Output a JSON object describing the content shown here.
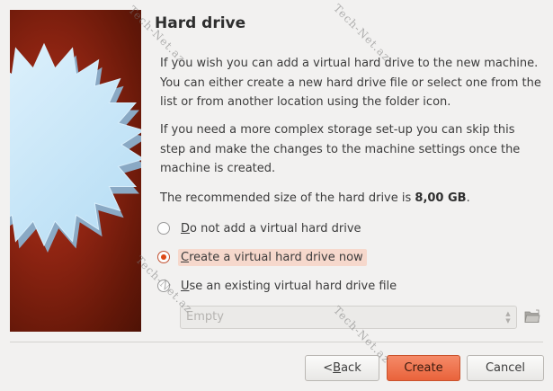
{
  "dialog": {
    "title": "Hard drive",
    "paragraph1": "If you wish you can add a virtual hard drive to the new machine. You can either create a new hard drive file or select one from the list or from another location using the folder icon.",
    "paragraph2": "If you need a more complex storage set-up you can skip this step and make the changes to the machine settings once the machine is created.",
    "recommended_prefix": "The recommended size of the hard drive is ",
    "recommended_size": "8,00 GB",
    "recommended_suffix": "."
  },
  "options": [
    {
      "label_mnemonic": "D",
      "label_rest": "o not add a virtual hard drive",
      "checked": false
    },
    {
      "label_mnemonic": "C",
      "label_rest": "reate a virtual hard drive now",
      "checked": true
    },
    {
      "label_mnemonic": "U",
      "label_rest": "se an existing virtual hard drive file",
      "checked": false
    }
  ],
  "existing_file": {
    "selected_value": "Empty",
    "disabled": true
  },
  "buttons": {
    "back_prefix": "< ",
    "back_mnemonic": "B",
    "back_rest": "ack",
    "create_label": "Create",
    "cancel_label": "Cancel"
  },
  "watermark_text": "Tech-Net.az",
  "colors": {
    "accent": "#e9633b",
    "banner_bg": "#8e2412",
    "star": "#c8e8fb"
  },
  "icons": {
    "folder": "folder-open-icon",
    "combo_arrows": "up-down-arrows-icon"
  }
}
